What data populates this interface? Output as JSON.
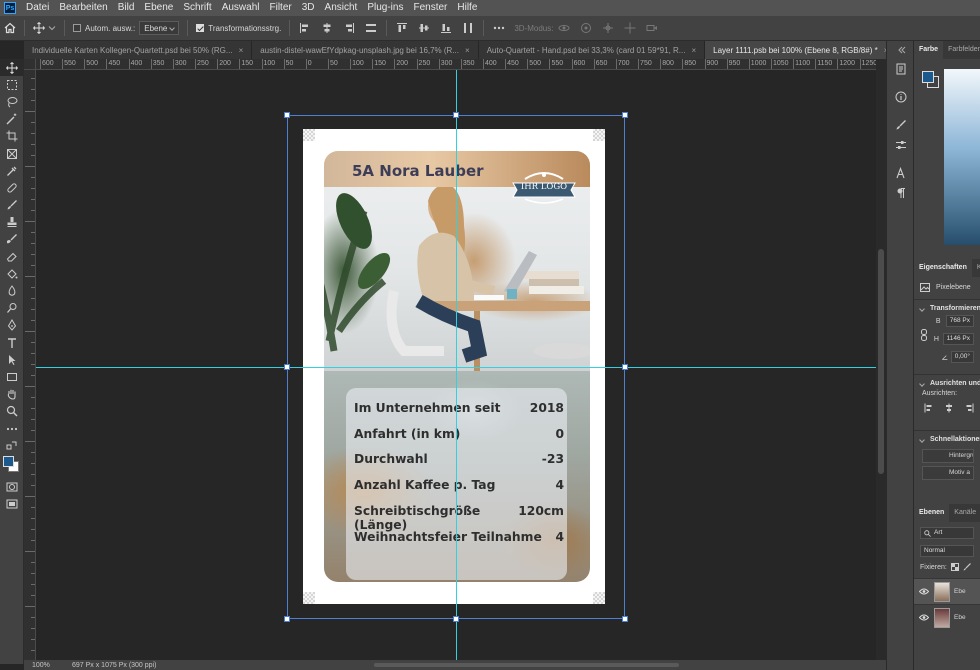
{
  "menu": [
    "Datei",
    "Bearbeiten",
    "Bild",
    "Ebene",
    "Schrift",
    "Auswahl",
    "Filter",
    "3D",
    "Ansicht",
    "Plug-ins",
    "Fenster",
    "Hilfe"
  ],
  "app_logo": "Ps",
  "options_bar": {
    "auto_select_label": "Autom. ausw.:",
    "auto_select_value": "Ebene",
    "transform_controls_label": "Transformationsstrg.",
    "mode_3d_label": "3D-Modus:"
  },
  "tabs": [
    {
      "label": "Individuelle Karten Kollegen-Quartett.psd bei 50% (RG...",
      "active": false
    },
    {
      "label": "austin-distel-wawEfYdpkag-unsplash.jpg bei 16,7% (R...",
      "active": false
    },
    {
      "label": "Auto-Quartett - Hand.psd bei 33,3% (card 01 59*91, R...",
      "active": false
    },
    {
      "label": "Layer 1111.psb bei 100% (Ebene 8, RGB/8#) *",
      "active": true
    }
  ],
  "tab_close": "×",
  "ruler_labels": [
    "600",
    "550",
    "500",
    "450",
    "400",
    "350",
    "300",
    "250",
    "200",
    "150",
    "100",
    "50",
    "0",
    "50",
    "100",
    "150",
    "200",
    "250",
    "300",
    "350",
    "400",
    "450",
    "500",
    "550",
    "600",
    "650",
    "700",
    "750",
    "800",
    "850",
    "900",
    "950",
    "1000",
    "1050",
    "1100",
    "1150",
    "1200",
    "1250"
  ],
  "card": {
    "name": "5A Nora Lauber",
    "logo_text": "IHR LOGO",
    "stats": [
      {
        "label": "Im Unternehmen seit",
        "value": "2018"
      },
      {
        "label": "Anfahrt (in km)",
        "value": "0"
      },
      {
        "label": "Durchwahl",
        "value": "-23"
      },
      {
        "label": "Anzahl Kaffee p. Tag",
        "value": "4"
      },
      {
        "label": "Schreibtischgröße (Länge)",
        "value": "120cm"
      },
      {
        "label": "Weihnachtsfeier Teilnahme",
        "value": "4"
      }
    ]
  },
  "status_bar": {
    "zoom": "100%",
    "doc_info": "697 Px x 1075 Px (300 ppi)"
  },
  "right_panel": {
    "color_tabs": [
      "Farbe",
      "Farbfelder"
    ],
    "properties_tabs": [
      "Eigenschaften",
      "K"
    ],
    "layer_type": "Pixelebene",
    "transform_section": "Transformieren",
    "width_label": "B",
    "width_value": "768 Px",
    "height_label": "H",
    "height_value": "1146 Px",
    "angle_value": "0,00°",
    "align_section": "Ausrichten und",
    "align_label": "Ausrichten:",
    "quick_actions_section": "Schnellaktionen",
    "quick_btn_1": "Hintergrund",
    "quick_btn_2": "Motiv a",
    "layers_tabs": [
      "Ebenen",
      "Kanäle"
    ],
    "filter_kind": "Art",
    "blend_mode": "Normal",
    "lock_label": "Fixieren:",
    "layers": [
      {
        "name": "Ebe",
        "active": true
      },
      {
        "name": "Ebe",
        "active": false
      }
    ]
  },
  "colors": {
    "foreground": "#1c5a8e",
    "background": "#ffffff",
    "guide": "#34d0e0",
    "transform": "#4f7fd1"
  }
}
